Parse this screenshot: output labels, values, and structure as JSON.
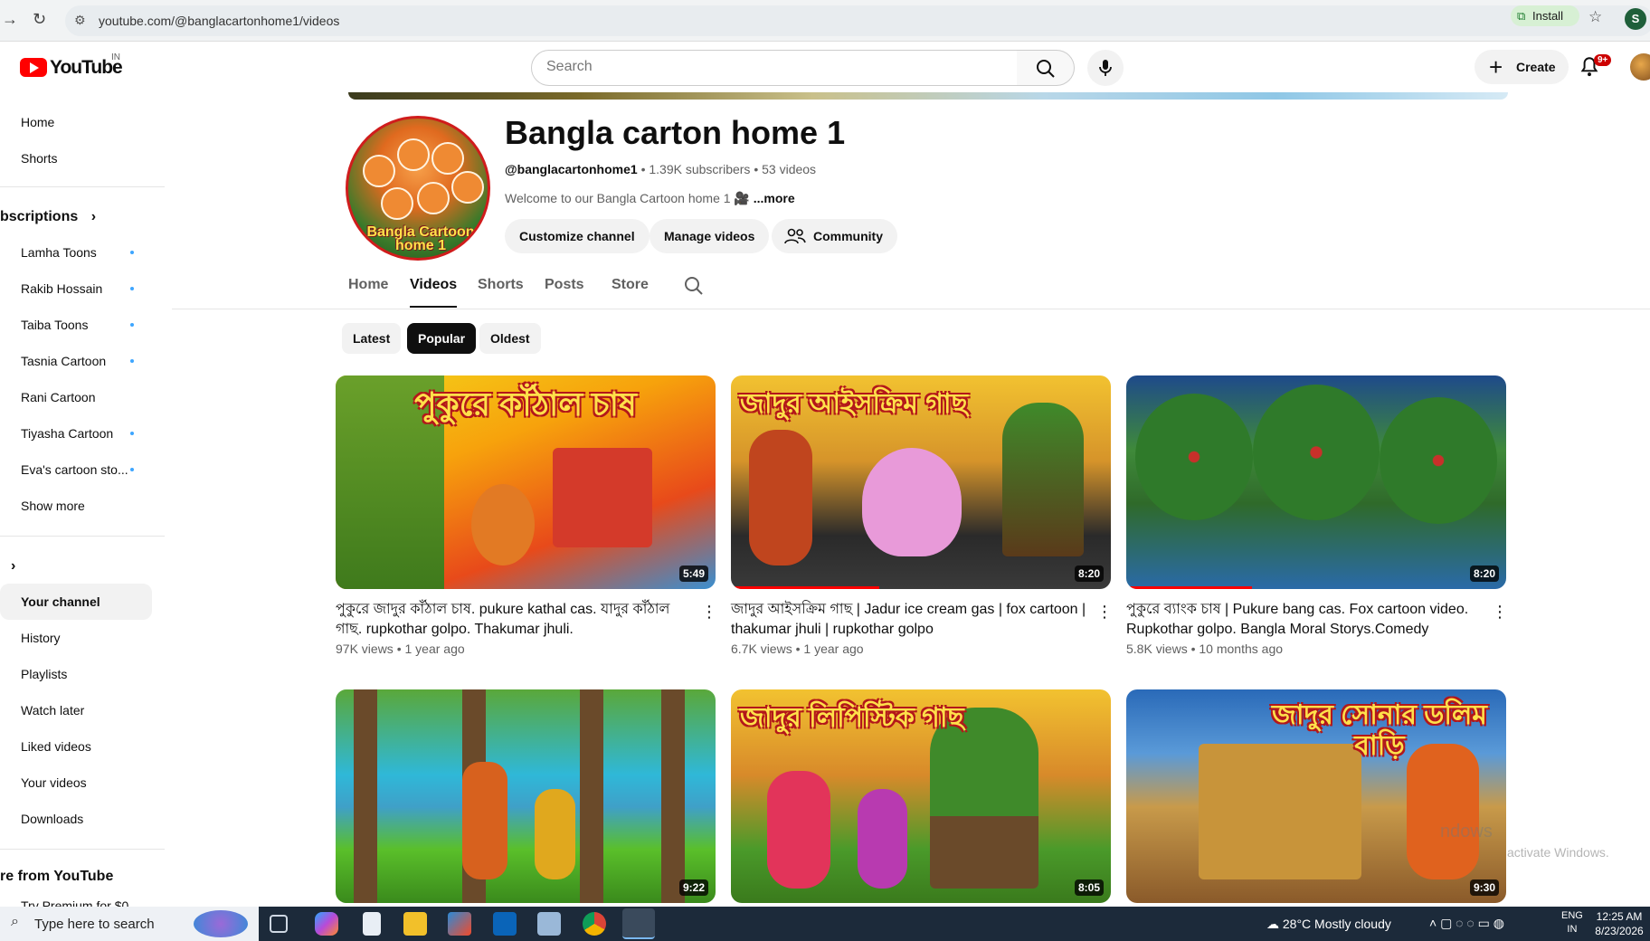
{
  "browser": {
    "url": "youtube.com/@banglacartonhome1/videos",
    "install_label": "Install",
    "profile_letter": "S"
  },
  "header": {
    "logo_text": "YouTube",
    "country_code": "IN",
    "search_placeholder": "Search",
    "create_label": "Create",
    "notification_badge": "9+"
  },
  "sidebar": {
    "top_items": [
      {
        "label": "Home"
      },
      {
        "label": "Shorts"
      }
    ],
    "subscriptions_heading": "bscriptions",
    "subscriptions": [
      {
        "label": "Lamha Toons",
        "new": true
      },
      {
        "label": "Rakib Hossain",
        "new": true
      },
      {
        "label": "Taiba Toons",
        "new": true
      },
      {
        "label": "Tasnia Cartoon",
        "new": true
      },
      {
        "label": "Rani Cartoon",
        "new": false
      },
      {
        "label": "Tiyasha Cartoon",
        "new": true
      },
      {
        "label": "Eva's cartoon sto...",
        "new": true
      }
    ],
    "show_more": "Show more",
    "you_heading": "",
    "you_items": [
      {
        "label": "Your channel",
        "active": true
      },
      {
        "label": "History"
      },
      {
        "label": "Playlists"
      },
      {
        "label": "Watch later"
      },
      {
        "label": "Liked videos"
      },
      {
        "label": "Your videos"
      },
      {
        "label": "Downloads"
      }
    ],
    "more_heading": "re from YouTube",
    "premium_partial": "Try Premium for $0"
  },
  "channel": {
    "name": "Bangla carton home 1",
    "handle": "@banglacartonhome1",
    "subscribers": "1.39K subscribers",
    "videos_count": "53 videos",
    "description": "Welcome to our Bangla Cartoon home 1 🎥",
    "more_label": "...more",
    "avatar_text": "Bangla Cartoon home 1",
    "buttons": {
      "customize": "Customize channel",
      "manage": "Manage videos",
      "community": "Community"
    }
  },
  "tabs": [
    {
      "label": "Home",
      "active": false
    },
    {
      "label": "Videos",
      "active": true
    },
    {
      "label": "Shorts",
      "active": false
    },
    {
      "label": "Posts",
      "active": false
    },
    {
      "label": "Store",
      "active": false
    }
  ],
  "filters": [
    {
      "label": "Latest",
      "active": false
    },
    {
      "label": "Popular",
      "active": true
    },
    {
      "label": "Oldest",
      "active": false
    }
  ],
  "videos": [
    {
      "thumb_text": "পুকুরে কাঁঠাল চাষ",
      "duration": "5:49",
      "title": "পুকুরে জাদুর কাঁঠাল চাষ. pukure kathal cas. যাদুর কাঁঠাল গাছ. rupkothar golpo. Thakumar jhuli.",
      "views": "97K views",
      "age": "1 year ago",
      "watched_fraction": 0.0
    },
    {
      "thumb_text": "জাদুর আইসক্রিম গাছ",
      "duration": "8:20",
      "title": "জাদুর আইসক্রিম গাছ | Jadur ice cream gas | fox cartoon | thakumar jhuli  | rupkothar golpo",
      "views": "6.7K views",
      "age": "1 year ago",
      "watched_fraction": 0.39
    },
    {
      "thumb_text": "",
      "duration": "8:20",
      "title": "পুকুরে ব্যাংক চাষ | Pukure bang cas. Fox cartoon video. Rupkothar golpo. Bangla Moral Storys.Comedy",
      "views": "5.8K views",
      "age": "10 months ago",
      "watched_fraction": 0.33
    },
    {
      "thumb_text": "",
      "duration": "9:22",
      "title": "",
      "views": "",
      "age": "",
      "watched_fraction": 0.0
    },
    {
      "thumb_text": "জাদুর লিপিস্টিক গাছ",
      "duration": "8:05",
      "title": "",
      "views": "",
      "age": "",
      "watched_fraction": 0.0
    },
    {
      "thumb_text": "জাদুর সোনার ডলিম বাড়ি",
      "duration": "9:30",
      "title": "",
      "views": "",
      "age": "",
      "watched_fraction": 0.0
    }
  ],
  "watermark": {
    "line1": "ndows",
    "line2": "activate Windows."
  },
  "taskbar": {
    "search_label": "Type here to search",
    "weather": "28°C  Mostly cloudy",
    "lang1": "ENG",
    "lang2": "IN",
    "time": "12:25 AM",
    "date": "8/23/2026"
  }
}
